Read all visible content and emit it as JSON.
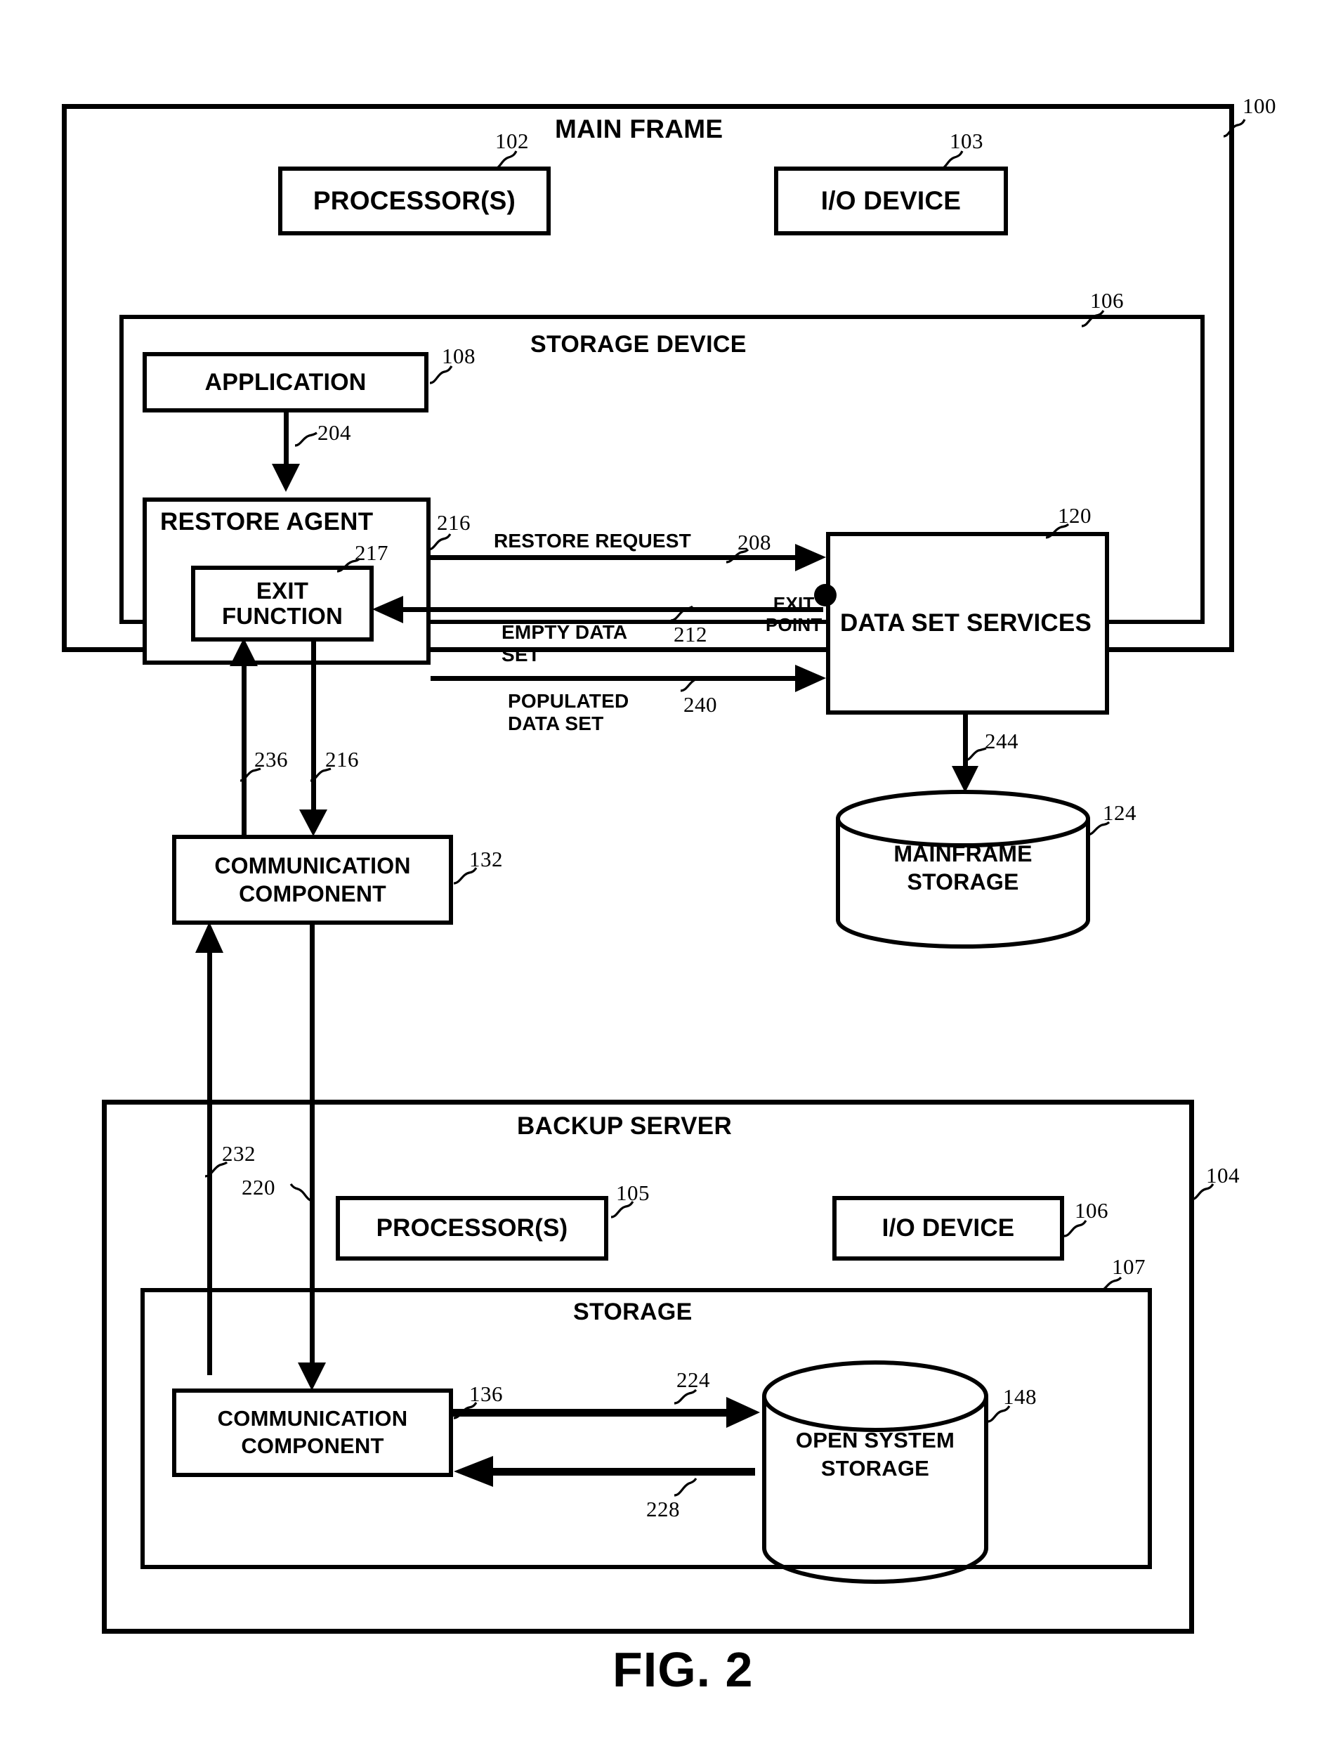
{
  "figure": {
    "caption": "FIG. 2"
  },
  "mainframe": {
    "title": "MAIN FRAME",
    "ref": "100",
    "processors": {
      "label": "PROCESSOR(S)",
      "ref": "102"
    },
    "io_device": {
      "label": "I/O DEVICE",
      "ref": "103"
    },
    "storage_device": {
      "title": "STORAGE DEVICE",
      "ref": "106",
      "application": {
        "label": "APPLICATION",
        "ref": "108"
      },
      "restore_agent": {
        "label": "RESTORE AGENT",
        "ref": "216"
      },
      "exit_function": {
        "label": "EXIT\nFUNCTION",
        "ref": "217"
      },
      "data_set_services": {
        "label": "DATA SET SERVICES",
        "ref": "120"
      },
      "exit_point": {
        "label": "EXIT\nPOINT"
      },
      "communication_component": {
        "label": "COMMUNICATION\nCOMPONENT",
        "ref": "132"
      },
      "mainframe_storage": {
        "label": "MAINFRAME\nSTORAGE",
        "ref": "124"
      },
      "flows": {
        "app_to_agent": "204",
        "restore_request": {
          "label": "RESTORE REQUEST",
          "ref": "208"
        },
        "empty_data_set": {
          "label": "EMPTY DATA\nSET",
          "ref": "212"
        },
        "populated_data_set": {
          "label": "POPULATED\nDATA SET",
          "ref": "240"
        },
        "services_to_storage": "244",
        "agent_to_comm": "216",
        "comm_to_agent": "236"
      }
    }
  },
  "backup_server": {
    "title": "BACKUP SERVER",
    "ref": "104",
    "processors": {
      "label": "PROCESSOR(S)",
      "ref": "105"
    },
    "io_device": {
      "label": "I/O DEVICE",
      "ref": "106"
    },
    "storage": {
      "title": "STORAGE",
      "ref": "107",
      "communication_component": {
        "label": "COMMUNICATION\nCOMPONENT",
        "ref": "136"
      },
      "open_system_storage": {
        "label": "OPEN SYSTEM\nSTORAGE",
        "ref": "148"
      },
      "flows": {
        "comm_to_oss": "224",
        "oss_to_comm": "228"
      }
    }
  },
  "cross_links": {
    "down_to_backup_comm": "220",
    "up_to_mainframe_comm": "232"
  },
  "colors": {
    "ink": "#000000",
    "paper": "#ffffff"
  }
}
